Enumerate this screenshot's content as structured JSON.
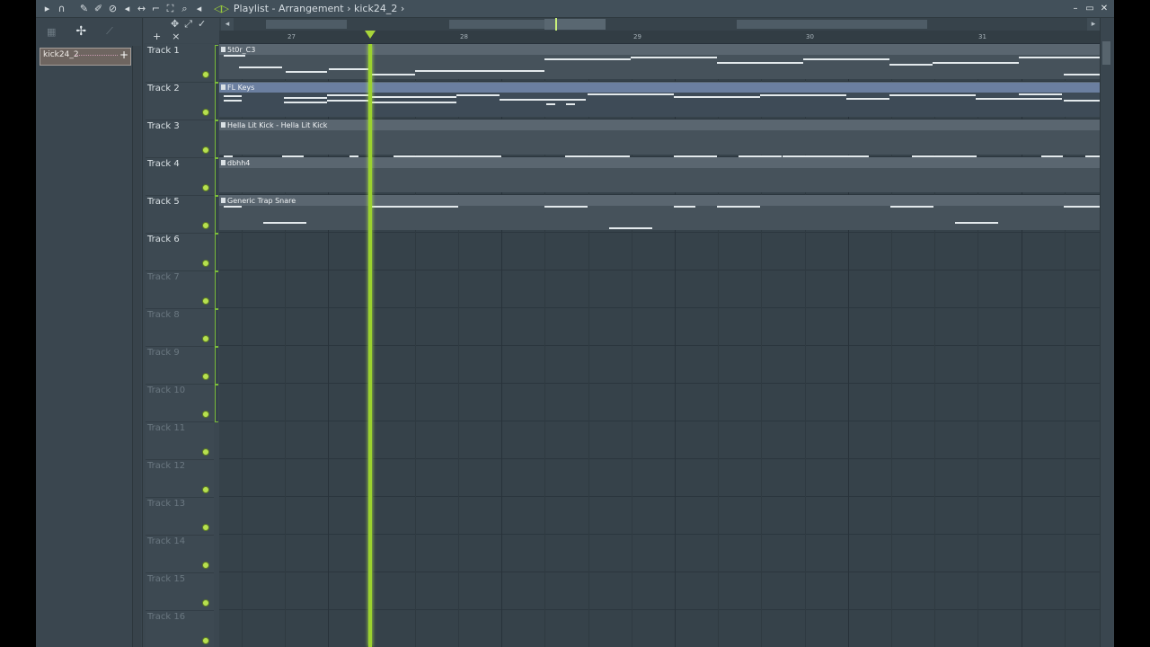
{
  "window": {
    "title": "Playlist - Arrangement",
    "breadcrumb_sep": "›",
    "breadcrumb_item": "kick24_2",
    "breadcrumb_end": "›",
    "minimize": "–",
    "restore": "▭",
    "close": "✕"
  },
  "toolbar": {
    "icons": [
      "menu-arrow-icon",
      "magnet-icon",
      "pencil-icon",
      "paint-icon",
      "delete-icon",
      "mute-icon",
      "slip-icon",
      "slice-icon",
      "select-icon",
      "zoom-icon",
      "playback-icon"
    ]
  },
  "left_panel": {
    "clip_name": "kick24_2",
    "clip_plus": "+"
  },
  "header": {
    "add_label": "+",
    "close_label": "×"
  },
  "ruler": {
    "bars": [
      "27",
      "28",
      "29",
      "30",
      "31"
    ]
  },
  "tracks": [
    {
      "label": "Track 1"
    },
    {
      "label": "Track 2"
    },
    {
      "label": "Track 3"
    },
    {
      "label": "Track 4"
    },
    {
      "label": "Track 5"
    },
    {
      "label": "Track 6"
    },
    {
      "label": "Track 7"
    },
    {
      "label": "Track 8"
    },
    {
      "label": "Track 9"
    },
    {
      "label": "Track 10"
    },
    {
      "label": "Track 11"
    },
    {
      "label": "Track 12"
    },
    {
      "label": "Track 13"
    },
    {
      "label": "Track 14"
    },
    {
      "label": "Track 15"
    },
    {
      "label": "Track 16"
    }
  ],
  "patterns": [
    {
      "name": "5t0r_C3"
    },
    {
      "name": "FL Keys"
    },
    {
      "name": "Hella Lit Kick - Hella Lit Kick"
    },
    {
      "name": "dbhh4"
    },
    {
      "name": "Generic Trap Snare"
    }
  ],
  "colors": {
    "playhead": "#9bd22f",
    "accent": "#a8d63a",
    "grid_bg": "#36424a"
  }
}
